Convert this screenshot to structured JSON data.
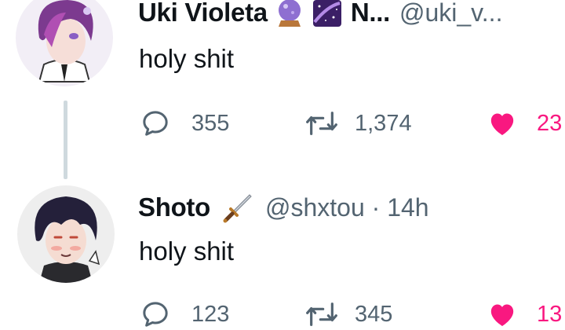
{
  "tweets": [
    {
      "author": {
        "name": "Uki Violeta",
        "name_suffix": "N...",
        "handle": "@uki_v...",
        "badges": [
          "crystal-ball-icon",
          "purple-galaxy-icon"
        ]
      },
      "text": "holy shit",
      "actions": {
        "replies": "355",
        "retweets": "1,374",
        "likes": "23"
      }
    },
    {
      "author": {
        "name": "Shoto",
        "handle": "@shxtou · 14h",
        "badges": [
          "dagger-icon"
        ]
      },
      "text": "holy shit",
      "actions": {
        "replies": "123",
        "retweets": "345",
        "likes": "13"
      }
    }
  ],
  "colors": {
    "like": "#f91880",
    "muted": "#536471",
    "thread_line": "#cfd9de"
  }
}
